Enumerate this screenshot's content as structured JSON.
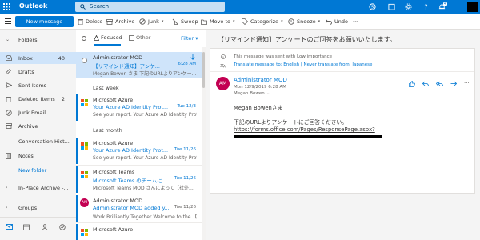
{
  "app": {
    "title": "Outlook"
  },
  "search": {
    "placeholder": "Search"
  },
  "topbar": {
    "notification_badge": "4",
    "icons": [
      "waffle-icon",
      "skype-icon",
      "calendar-icon",
      "gear-icon",
      "help-icon",
      "notifications-icon"
    ]
  },
  "commands": {
    "new_message": "New message",
    "delete": "Delete",
    "archive": "Archive",
    "junk": "Junk",
    "sweep": "Sweep",
    "move_to": "Move to",
    "categorize": "Categorize",
    "snooze": "Snooze",
    "undo": "Undo",
    "more": "···"
  },
  "nav": {
    "folders_label": "Folders",
    "items": [
      {
        "label": "Inbox",
        "count": "40",
        "icon": "inbox-icon",
        "selected": true
      },
      {
        "label": "Drafts",
        "count": "",
        "icon": "pencil-icon"
      },
      {
        "label": "Sent Items",
        "count": "",
        "icon": "send-icon"
      },
      {
        "label": "Deleted Items",
        "count": "2",
        "icon": "trash-icon"
      },
      {
        "label": "Junk Email",
        "count": "",
        "icon": "block-icon"
      },
      {
        "label": "Archive",
        "count": "",
        "icon": "archive-icon"
      },
      {
        "label": "Conversation Hist...",
        "count": "",
        "icon": ""
      },
      {
        "label": "Notes",
        "count": "",
        "icon": "note-icon"
      }
    ],
    "new_folder": "New folder",
    "in_place_archive": "In-Place Archive -...",
    "groups": "Groups"
  },
  "list": {
    "tab_focused": "Focused",
    "tab_other": "Other",
    "filter": "Filter",
    "sections": {
      "last_week": "Last week",
      "last_month": "Last month"
    },
    "messages": [
      {
        "sender": "Administrator MOD",
        "subject": "【リマインド通知】アンケ...",
        "time": "6:28 AM",
        "preview": "Megan Bowen さま 下記のURLよりアンケー..."
      },
      {
        "sender": "Microsoft Azure",
        "subject": "Your Azure AD Identity Prot...",
        "time": "Tue 12/3",
        "preview": "See your report. Your Azure AD Identity Prot..."
      },
      {
        "sender": "Microsoft Azure",
        "subject": "Your Azure AD Identity Prot...",
        "time": "Tue 11/26",
        "preview": "See your report. Your Azure AD Identity Prot..."
      },
      {
        "sender": "Microsoft Teams",
        "subject": "Microsoft Teams のチームに...",
        "time": "Tue 11/26",
        "preview": "Microsoft Teams MOD さんによって【社外..."
      },
      {
        "sender": "Administrator MOD",
        "subject": "Administrator MOD added y...",
        "time": "Tue 11/26",
        "preview": "Work Brilliantly Together Welcome to the 【..."
      },
      {
        "sender": "Microsoft Azure",
        "subject": "",
        "time": "",
        "preview": ""
      }
    ]
  },
  "reading": {
    "title": "【リマインド通知】アンケートのご回答をお願いいたします。",
    "info_importance": "This message was sent with Low importance",
    "info_translate": "Translate message to: English | Never translate from: Japanese",
    "avatar_initials": "AM",
    "sender": "Administrator MOD",
    "date": "Mon 12/9/2019 6:28 AM",
    "to": "Megan Bowen",
    "body": {
      "greeting": "Megan Bowenさま",
      "line1": "下記のURLよりアンケートにご回答ください。",
      "link": "https://forms.office.com/Pages/ResponsePage.aspx?"
    }
  },
  "colors": {
    "accent": "#0078d4",
    "selected": "#cfe4fa",
    "avatar": "#c30052"
  }
}
